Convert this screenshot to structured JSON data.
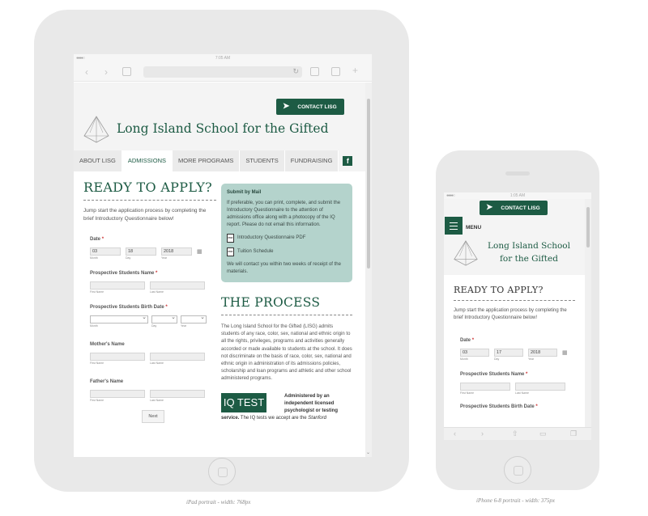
{
  "ipad": {
    "status_time": "7:05 AM",
    "contact_label": "CONTACT LISG",
    "school_name": "Long Island School for the Gifted",
    "tabs": [
      "ABOUT LISG",
      "ADMISSIONS",
      "MORE PROGRAMS",
      "STUDENTS",
      "FUNDRAISING"
    ],
    "facebook_icon": "f",
    "heading": "READY TO APPLY?",
    "intro": "Jump start the application process by completing the brief Introductory Questionnaire below!",
    "form": {
      "date_label": "Date",
      "required_mark": "*",
      "date_month": "03",
      "date_day": "18",
      "date_year": "2018",
      "sub_month": "Month",
      "sub_day": "Day",
      "sub_year": "Year",
      "student_name_label": "Prospective Students Name",
      "sub_first": "First Name",
      "sub_last": "Last Name",
      "birth_date_label": "Prospective Students Birth Date",
      "mother_label": "Mother's Name",
      "father_label": "Father's Name",
      "next_label": "Next"
    },
    "mail": {
      "title": "Submit by Mail",
      "body": "If preferable, you can print, complete, and submit the Introductory Questionnaire to the attention of admissions office along with a photocopy of the IQ report. Please do not email this information.",
      "link1": "Introductory Questionnaire PDF",
      "link2": "Tuition Schedule",
      "pdf_icon_text": "PDF",
      "footer": "We will contact you within two weeks of receipt of the materials."
    },
    "process_heading": "THE PROCESS",
    "process_text": "The Long Island School for the Gifted (LISG) admits students of any race, color, sex, national and ethnic origin to all the rights, privileges, programs and activities generally accorded or made available to students at the school. It does not discriminate on the basis of race, color, sex, national and ethnic origin in administration of its admissions policies, scholarship and loan programs and athletic and other school administered programs.",
    "iq_box": "IQ TEST",
    "iq_text": "Administered by an independent licensed psychologist or testing",
    "iq_cont_bold": "service.",
    "iq_cont": " The IQ tests we accept are the ",
    "iq_cont_italic": "Stanford"
  },
  "iphone": {
    "status_time": "1:05 AM",
    "contact_label": "CONTACT LISG",
    "menu_label": "MENU",
    "school_name_1": "Long Island School",
    "school_name_2": "for the Gifted",
    "heading": "READY TO APPLY?",
    "intro": "Jump start the application process by completing the brief Introductory Questionnaire below!",
    "date_label": "Date",
    "required_mark": "*",
    "date_month": "03",
    "date_day": "17",
    "date_year": "2018",
    "sub_month": "Month",
    "sub_day": "Day",
    "sub_year": "Year",
    "student_name_label": "Prospective Students Name",
    "sub_first": "First Name",
    "sub_last": "Last Name",
    "birth_date_label": "Prospective Students Birth Date"
  },
  "captions": {
    "ipad": "iPad portrait - width: 768px",
    "iphone": "iPhone 6-8 portrait - width: 375px"
  },
  "colors": {
    "brand_green": "#1d5b44",
    "mail_box": "#b4d3cc"
  }
}
